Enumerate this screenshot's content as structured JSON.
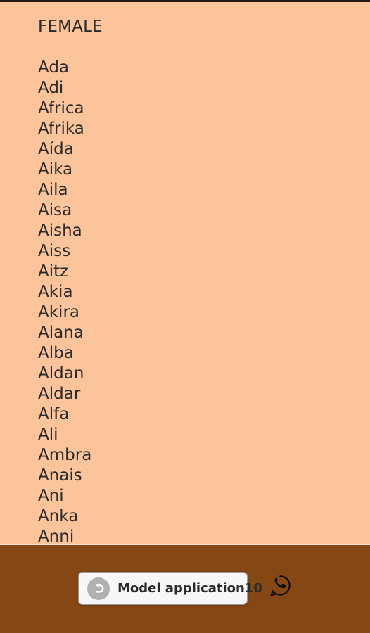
{
  "theme": {
    "content_background": "#fbc49a",
    "bottom_bar_background": "#854713",
    "text_color": "#2b2b2b",
    "button_background": "#f7f7f7",
    "separator_color": "#f6ddd0"
  },
  "content": {
    "section_title": "FEMALE",
    "names": [
      "Ada",
      "Adi",
      "Africa",
      "Afrika",
      "Aída",
      "Aika",
      "Aila",
      "Aisa",
      "Aisha",
      "Aiss",
      "Aitz",
      "Akia",
      "Akira",
      "Alana",
      "Alba",
      "Aldan",
      "Aldar",
      "Alfa",
      "Ali",
      "Ambra",
      "Anais",
      "Ani",
      "Anka",
      "Anni"
    ]
  },
  "bottom_bar": {
    "app_button_label": "Model application10",
    "back_icon_name": "back-arrow-icon",
    "whatsapp_icon_name": "whatsapp-icon"
  }
}
